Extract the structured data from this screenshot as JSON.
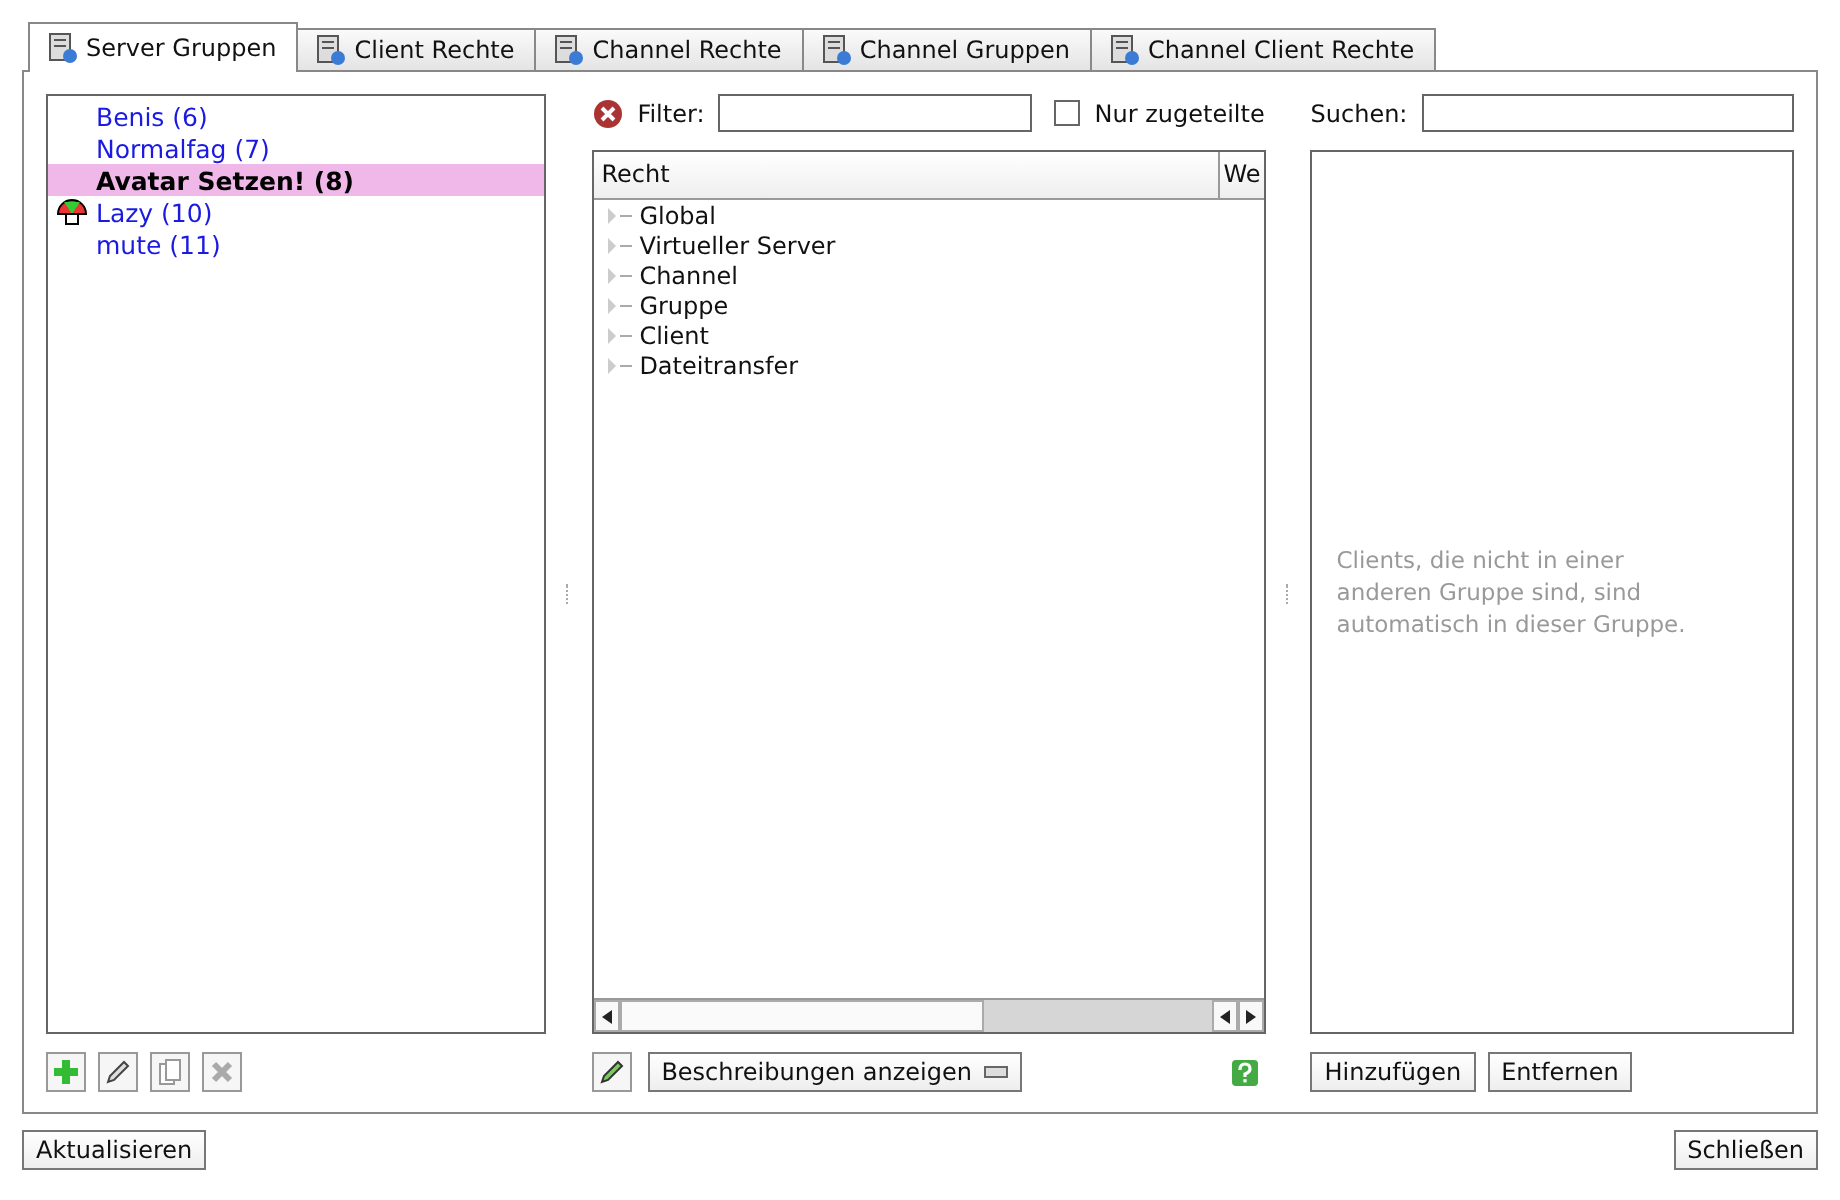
{
  "tabs": [
    {
      "label": "Server Gruppen",
      "selected": true
    },
    {
      "label": "Client Rechte",
      "selected": false
    },
    {
      "label": "Channel Rechte",
      "selected": false
    },
    {
      "label": "Channel Gruppen",
      "selected": false
    },
    {
      "label": "Channel Client Rechte",
      "selected": false
    }
  ],
  "groups": [
    {
      "label": "Benis (6)",
      "selected": false,
      "has_icon": false
    },
    {
      "label": "Normalfag (7)",
      "selected": false,
      "has_icon": false
    },
    {
      "label": "Avatar Setzen! (8)",
      "selected": true,
      "has_icon": false
    },
    {
      "label": "Lazy (10)",
      "selected": false,
      "has_icon": true
    },
    {
      "label": "mute (11)",
      "selected": false,
      "has_icon": false
    }
  ],
  "filter": {
    "label": "Filter:"
  },
  "only_assigned": {
    "label": "Nur zugeteilte",
    "checked": false
  },
  "table": {
    "columns": [
      "Recht",
      "We"
    ],
    "rows": [
      "Global",
      "Virtueller Server",
      "Channel",
      "Gruppe",
      "Client",
      "Dateitransfer"
    ]
  },
  "descriptions_button": "Beschreibungen anzeigen",
  "search": {
    "label": "Suchen:"
  },
  "clients_note": "Clients, die nicht in einer anderen Gruppe sind, sind automatisch in dieser Gruppe.",
  "client_buttons": [
    "Hinzufügen",
    "Entfernen"
  ],
  "footer_buttons": [
    "Aktualisieren",
    "Schließen"
  ]
}
